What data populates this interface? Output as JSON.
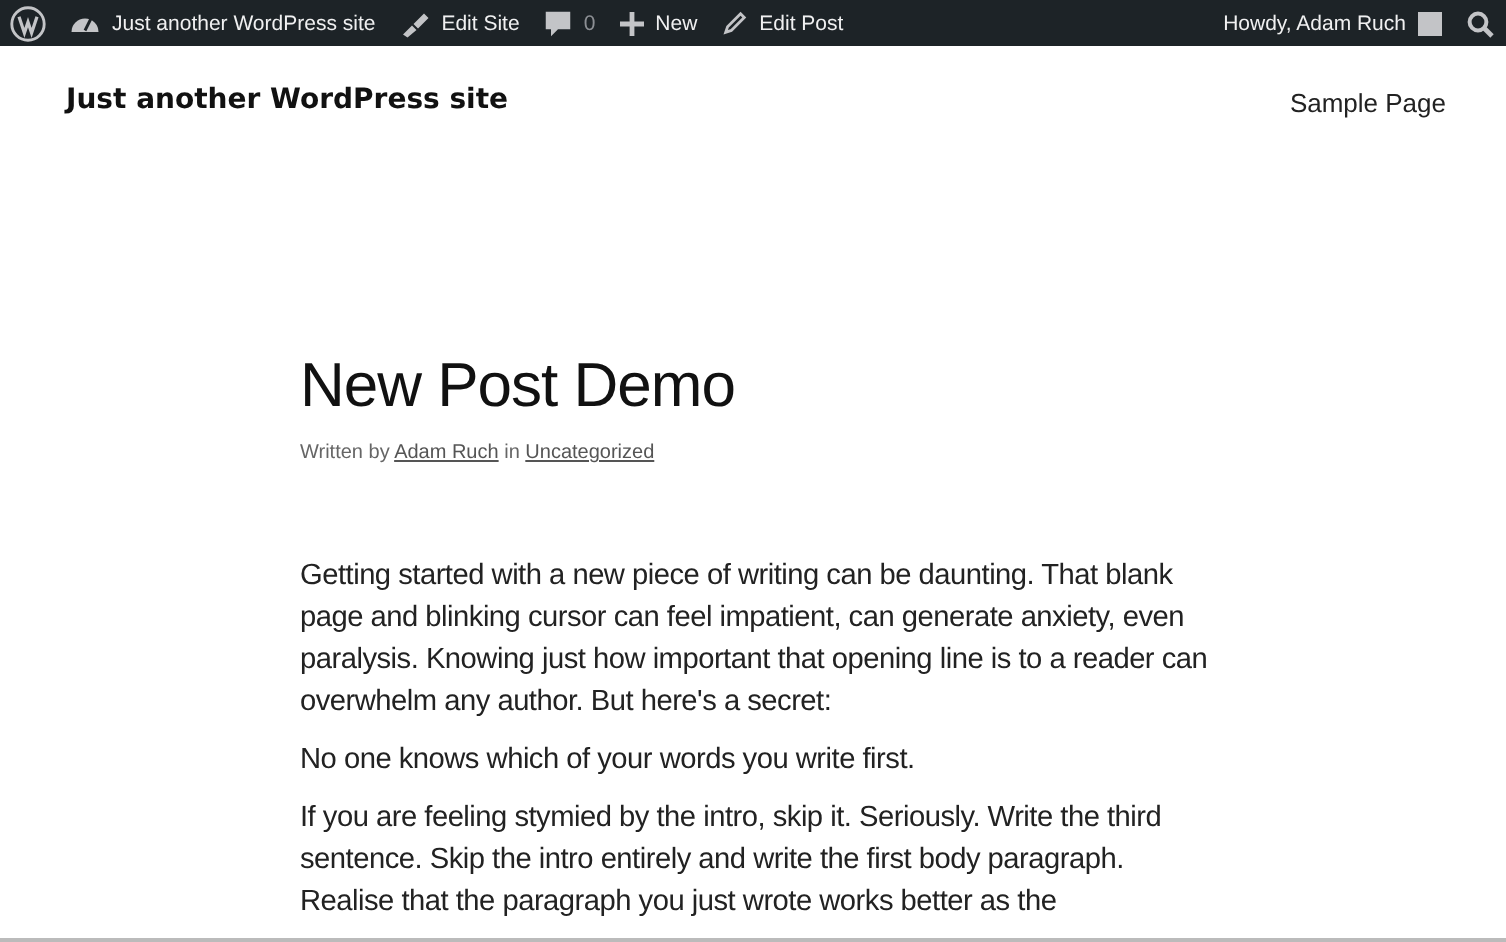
{
  "admin_bar": {
    "items": [
      {
        "kind": "logo"
      },
      {
        "kind": "site",
        "label": "Just another WordPress site"
      },
      {
        "kind": "brush",
        "label": "Edit Site"
      },
      {
        "kind": "comments",
        "label": "0"
      },
      {
        "kind": "new",
        "label": "New"
      },
      {
        "kind": "edit",
        "label": "Edit Post"
      }
    ],
    "greeting": "Howdy, Adam Ruch"
  },
  "header": {
    "site_title": "Just another WordPress site",
    "nav": [
      "Sample Page"
    ]
  },
  "post": {
    "title": "New Post Demo",
    "meta": {
      "written_by": "Written by",
      "author": "Adam Ruch",
      "in": "in",
      "category": "Uncategorized"
    },
    "paragraphs": [
      "Getting started with a new piece of writing can be daunting. That blank page and blinking cursor can feel impatient, can generate anxiety, even paralysis. Knowing just how important that opening line is to a reader can overwhelm any author. But here's a secret:",
      "No one knows which of your words you write first.",
      "If you are feeling stymied by the intro, skip it. Seriously. Write the third sentence. Skip the intro entirely and write the first body paragraph. Realise that the paragraph you just wrote works better as the"
    ]
  }
}
